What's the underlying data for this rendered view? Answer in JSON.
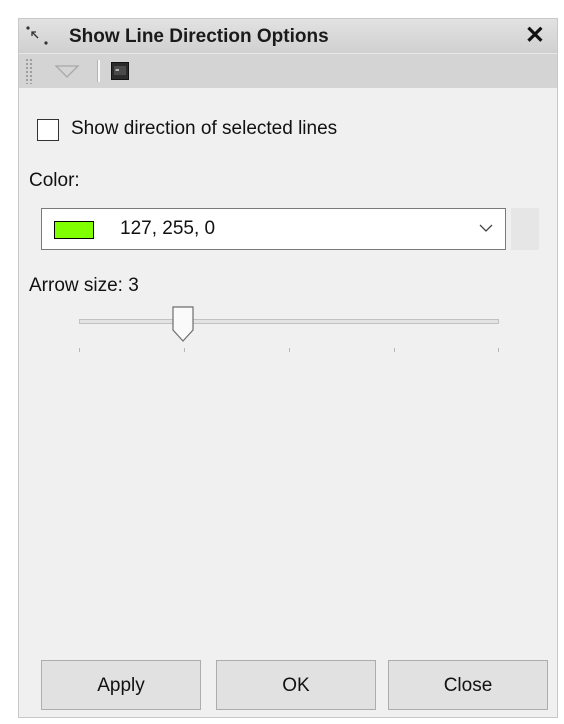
{
  "window": {
    "title": "Show Line Direction Options",
    "title_icon": "line-direction-icon",
    "close_symbol": "✕"
  },
  "toolbar": {
    "icons": [
      "grip-icon",
      "dropdown-triangle-icon",
      "console-icon"
    ]
  },
  "options": {
    "show_direction_label": "Show direction of selected lines",
    "show_direction_checked": false,
    "color_label": "Color:",
    "color_value": "127, 255, 0",
    "color_swatch": "#7fff00",
    "arrow_size_label": "Arrow size: 3",
    "arrow_size": 3,
    "arrow_size_fraction": 0.25
  },
  "buttons": {
    "apply": "Apply",
    "ok": "OK",
    "close": "Close"
  }
}
